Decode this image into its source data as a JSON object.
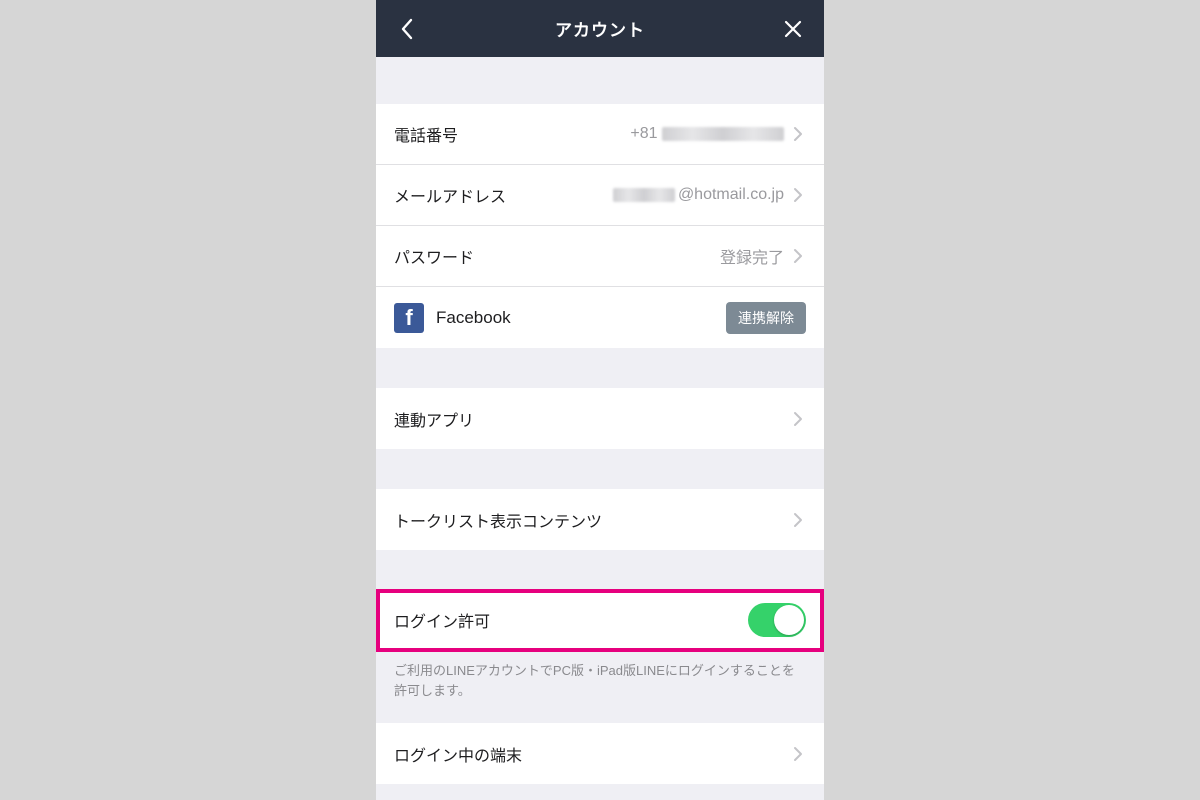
{
  "nav": {
    "title": "アカウント"
  },
  "rows": {
    "phone": {
      "label": "電話番号",
      "prefix": "+81"
    },
    "email": {
      "label": "メールアドレス",
      "suffix": "@hotmail.co.jp"
    },
    "password": {
      "label": "パスワード",
      "value": "登録完了"
    },
    "facebook": {
      "label": "Facebook",
      "unlink": "連携解除"
    },
    "linkedApps": {
      "label": "連動アプリ"
    },
    "talkList": {
      "label": "トークリスト表示コンテンツ"
    },
    "loginAllow": {
      "label": "ログイン許可",
      "toggle": true
    },
    "loggedDevices": {
      "label": "ログイン中の端末"
    }
  },
  "descriptions": {
    "loginAllow": "ご利用のLINEアカウントでPC版・iPad版LINEにログインすることを許可します。"
  }
}
